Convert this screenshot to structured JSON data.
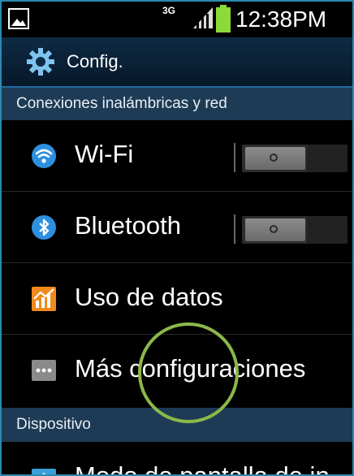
{
  "status_bar": {
    "network_type": "3G",
    "time": "12:38PM",
    "icons": [
      "image-icon",
      "signal-icon",
      "battery-icon"
    ]
  },
  "action_bar": {
    "title": "Config.",
    "icon": "gear-icon"
  },
  "sections": [
    {
      "header": "Conexiones inalámbricas y red",
      "items": [
        {
          "label": "Wi-Fi",
          "icon": "wifi-icon",
          "toggle": "off"
        },
        {
          "label": "Bluetooth",
          "icon": "bluetooth-icon",
          "toggle": "off"
        },
        {
          "label": "Uso de datos",
          "icon": "data-usage-icon"
        },
        {
          "label": "Más configuraciones",
          "icon": "more-icon"
        }
      ]
    },
    {
      "header": "Dispositivo",
      "items": [
        {
          "label": "Modo de pantalla de in",
          "icon": "home-icon"
        }
      ]
    }
  ],
  "colors": {
    "action_bar": "#0e2a44",
    "section_header": "#1e3b55",
    "accent": "#2a8ab0",
    "annotation_circle": "#8cb84a"
  }
}
